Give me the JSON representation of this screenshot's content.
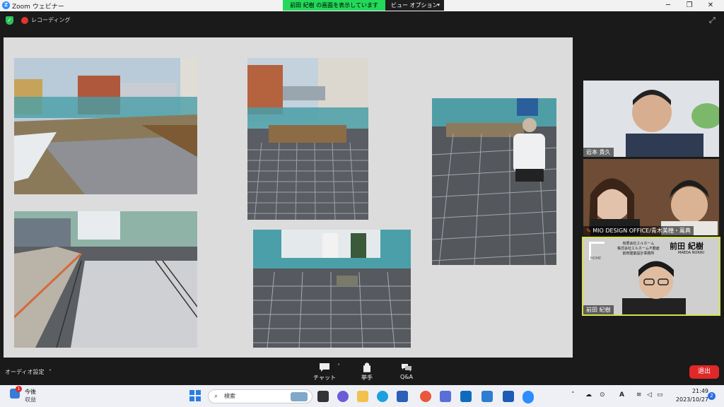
{
  "titlebar": {
    "app_title": "Zoom ウェビナー",
    "share_banner": "前田 紀樹 の画面を表示しています",
    "view_options": "ビュー オプション"
  },
  "status": {
    "recording_label": "レコーディング"
  },
  "participants": [
    {
      "name": "岩本 貴久"
    },
    {
      "name": "MIO DESIGN OFFICE/青木美穂・萬典"
    },
    {
      "name": "前田 紀樹",
      "company_lines": [
        "有限会社エルホーム",
        "株式会社エルホーム不動産",
        "前田建築設計事務所"
      ],
      "nameplate": "前田 紀樹",
      "nameplate_roman": "MAEDA NORIKI",
      "logo_text": "HOME"
    }
  ],
  "controls": {
    "audio_settings": "オーディオ設定",
    "chat": "チャット",
    "raise_hand": "挙手",
    "qa": "Q&A",
    "leave": "退出"
  },
  "taskbar": {
    "weather_line1": "今後",
    "weather_line2": "収益",
    "weather_badge": "1",
    "search_placeholder": "検索",
    "time": "21:49",
    "date": "2023/10/27",
    "notification_count": "2"
  },
  "colors": {
    "zoom_blue": "#2d8cff",
    "share_green": "#23d959",
    "leave_red": "#e02828",
    "active_speaker": "#d6e24a"
  }
}
